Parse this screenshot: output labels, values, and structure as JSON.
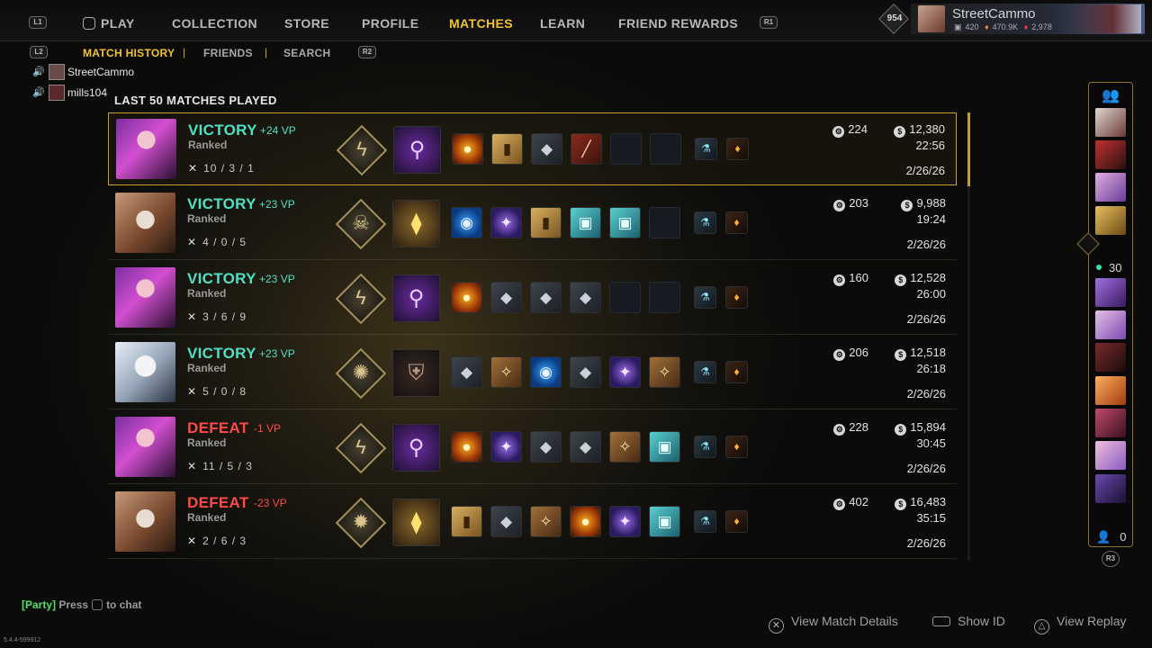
{
  "topnav": {
    "l1": "L1",
    "r1": "R1",
    "items": [
      "PLAY",
      "COLLECTION",
      "STORE",
      "PROFILE",
      "MATCHES",
      "LEARN",
      "FRIEND REWARDS"
    ],
    "active": "MATCHES"
  },
  "player": {
    "rank": "954",
    "name": "StreetCammo",
    "currency1": "420",
    "currency2": "470.9K",
    "currency3": "2,978"
  },
  "subnav": {
    "l2": "L2",
    "r2": "R2",
    "items": [
      "MATCH HISTORY",
      "FRIENDS",
      "SEARCH"
    ],
    "sep": "|"
  },
  "voice": [
    {
      "name": "StreetCammo"
    },
    {
      "name": "mills104"
    }
  ],
  "section_title": "LAST 50 MATCHES PLAYED",
  "matches": [
    {
      "portrait": "psy",
      "result": "VICTORY",
      "vp": "+24 VP",
      "mode": "Ranked",
      "kda": "10 / 3 / 1",
      "relic": "ϟ",
      "crest": "purple",
      "crest_icon": "⚲",
      "items": [
        "fire",
        "gold",
        "steel",
        "red",
        "empty",
        "empty"
      ],
      "score": "224",
      "gold": "12,380",
      "duration": "22:56",
      "date": "2/26/26"
    },
    {
      "portrait": "zombie",
      "result": "VICTORY",
      "vp": "+23 VP",
      "mode": "Ranked",
      "kda": "4 / 0 / 5",
      "relic": "☠",
      "crest": "yellow",
      "crest_icon": "⧫",
      "items": [
        "blue",
        "purple",
        "gold",
        "teal",
        "teal",
        "empty"
      ],
      "score": "203",
      "gold": "9,988",
      "duration": "19:24",
      "date": "2/26/26"
    },
    {
      "portrait": "psy",
      "result": "VICTORY",
      "vp": "+23 VP",
      "mode": "Ranked",
      "kda": "3 / 6 / 9",
      "relic": "ϟ",
      "crest": "purple",
      "crest_icon": "⚲",
      "items": [
        "fire",
        "steel",
        "steel",
        "steel",
        "empty",
        "empty"
      ],
      "score": "160",
      "gold": "12,528",
      "duration": "26:00",
      "date": "2/26/26"
    },
    {
      "portrait": "ice",
      "result": "VICTORY",
      "vp": "+23 VP",
      "mode": "Ranked",
      "kda": "5 / 0 / 8",
      "relic": "✺",
      "crest": "dark",
      "crest_icon": "⛨",
      "items": [
        "steel",
        "bronze",
        "blue",
        "steel",
        "purple",
        "bronze"
      ],
      "score": "206",
      "gold": "12,518",
      "duration": "26:18",
      "date": "2/26/26"
    },
    {
      "portrait": "psy",
      "result": "DEFEAT",
      "vp": "-1 VP",
      "mode": "Ranked",
      "kda": "11 / 5 / 3",
      "relic": "ϟ",
      "crest": "purple",
      "crest_icon": "⚲",
      "items": [
        "fire",
        "purple",
        "steel",
        "steel",
        "bronze",
        "teal"
      ],
      "score": "228",
      "gold": "15,894",
      "duration": "30:45",
      "date": "2/26/26"
    },
    {
      "portrait": "zombie",
      "result": "DEFEAT",
      "vp": "-23 VP",
      "mode": "Ranked",
      "kda": "2 / 6 / 3",
      "relic": "✹",
      "crest": "yellow",
      "crest_icon": "⧫",
      "items": [
        "gold",
        "steel",
        "bronze",
        "fire",
        "purple",
        "teal"
      ],
      "score": "402",
      "gold": "16,483",
      "duration": "35:15",
      "date": "2/26/26"
    }
  ],
  "item_glyphs": {
    "fire": "●",
    "gold": "▮",
    "steel": "◆",
    "red": "╱",
    "teal": "▣",
    "blue": "◉",
    "purple": "✦",
    "bronze": "✧",
    "empty": ""
  },
  "consumables": {
    "vial": "⚗",
    "ember": "♦"
  },
  "sidebar": {
    "online_count": "30",
    "pending_count": "0",
    "r3": "R3"
  },
  "chat": {
    "party": "[Party]",
    "press": "Press",
    "to_chat": "to chat"
  },
  "hints": {
    "details": "View Match Details",
    "show_id": "Show ID",
    "replay": "View Replay"
  },
  "version": "5.4.4-599912",
  "colors": {
    "accent": "#f2c230",
    "victory": "#4fe0c4",
    "defeat": "#ff4a48",
    "frame": "#c99c33"
  }
}
